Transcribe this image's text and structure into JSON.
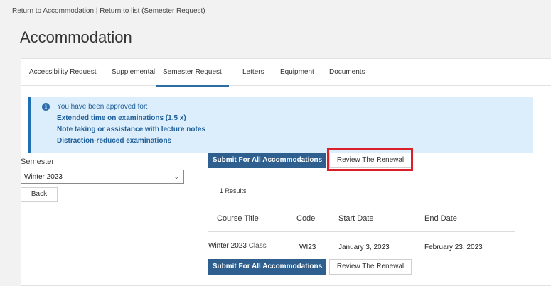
{
  "breadcrumb": {
    "link1": "Return to Accommodation",
    "separator": "|",
    "link2": "Return to list (Semester Request)"
  },
  "page_title": "Accommodation",
  "tabs": [
    {
      "label": "Accessibility Request",
      "active": false
    },
    {
      "label": "Supplemental",
      "active": false
    },
    {
      "label": "Semester Request",
      "active": true
    },
    {
      "label": "Letters",
      "active": false
    },
    {
      "label": "Equipment",
      "active": false
    },
    {
      "label": "Documents",
      "active": false
    }
  ],
  "alert": {
    "icon": "info-icon",
    "intro": "You have been approved for:",
    "items": [
      "Extended time on examinations (1.5 x)",
      "Note taking or assistance with lecture notes",
      "Distraction-reduced examinations"
    ]
  },
  "semester": {
    "label": "Semester",
    "selected": "Winter 2023",
    "back_label": "Back"
  },
  "actions": {
    "submit_label": "Submit For All Accommodations",
    "review_label": "Review The Renewal"
  },
  "results": {
    "count_text": "1 Results",
    "columns": [
      "Course Title",
      "Code",
      "Start Date",
      "End Date"
    ],
    "rows": [
      {
        "course_title_term": "Winter 2023",
        "course_title_suffix": "Class",
        "code": "WI23",
        "start_date": "January 3, 2023",
        "end_date": "February 23, 2023"
      }
    ]
  },
  "colors": {
    "primary_button": "#2e5f8f",
    "alert_background": "#dceefb",
    "alert_border": "#1f6fb3",
    "highlight": "#d9202a"
  }
}
